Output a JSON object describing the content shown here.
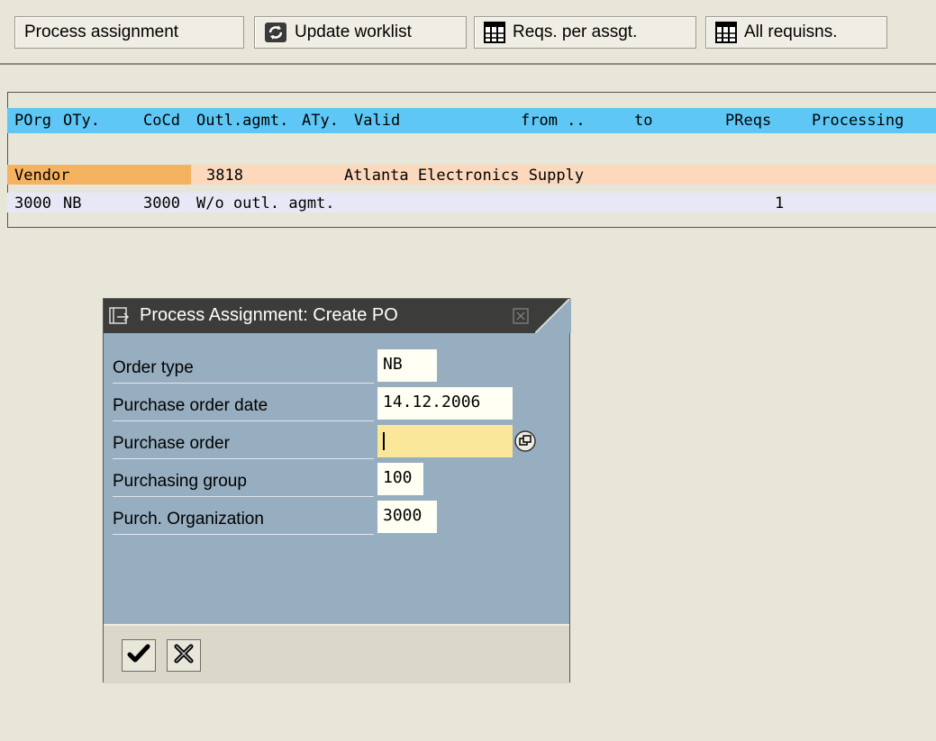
{
  "toolbar": {
    "process_assignment": "Process assignment",
    "update_worklist": "Update worklist",
    "reqs_per_assgt": "Reqs. per assgt.",
    "all_requisns": "All requisns."
  },
  "list": {
    "header": {
      "porg": "POrg",
      "oty": "OTy.",
      "cocd": "CoCd",
      "outl_agmt": "Outl.agmt.",
      "aty": "ATy.",
      "valid": "Valid",
      "from": "from ..",
      "to": "to",
      "preqs": "PReqs",
      "processing": "Processing"
    },
    "vendor_row": {
      "label": "Vendor",
      "number": "3818",
      "name": "Atlanta Electronics Supply"
    },
    "data_row": {
      "porg": "3000",
      "oty": "NB",
      "cocd": "3000",
      "outl_agmt": "W/o outl. agmt.",
      "preqs": "1"
    }
  },
  "dialog": {
    "title": "Process Assignment: Create PO",
    "fields": [
      {
        "label": "Order type",
        "value": "NB"
      },
      {
        "label": "Purchase order date",
        "value": "14.12.2006"
      },
      {
        "label": "Purchase order",
        "value": ""
      },
      {
        "label": "Purchasing group",
        "value": "100"
      },
      {
        "label": "Purch. Organization",
        "value": "3000"
      }
    ]
  },
  "colors": {
    "header_bg": "#5ec7f5",
    "vendor_bg": "#fcd9bd",
    "vendor_label_bg": "#f5b25f",
    "data_row_bg": "#e6e9f5",
    "dialog_bg": "#96aebf",
    "focused_input_bg": "#fae79a"
  },
  "icons": [
    "refresh-icon",
    "table-grid-icon",
    "table-grid-icon",
    "window-icon",
    "close-icon",
    "value-help-icon",
    "checkmark-icon",
    "cancel-icon"
  ]
}
